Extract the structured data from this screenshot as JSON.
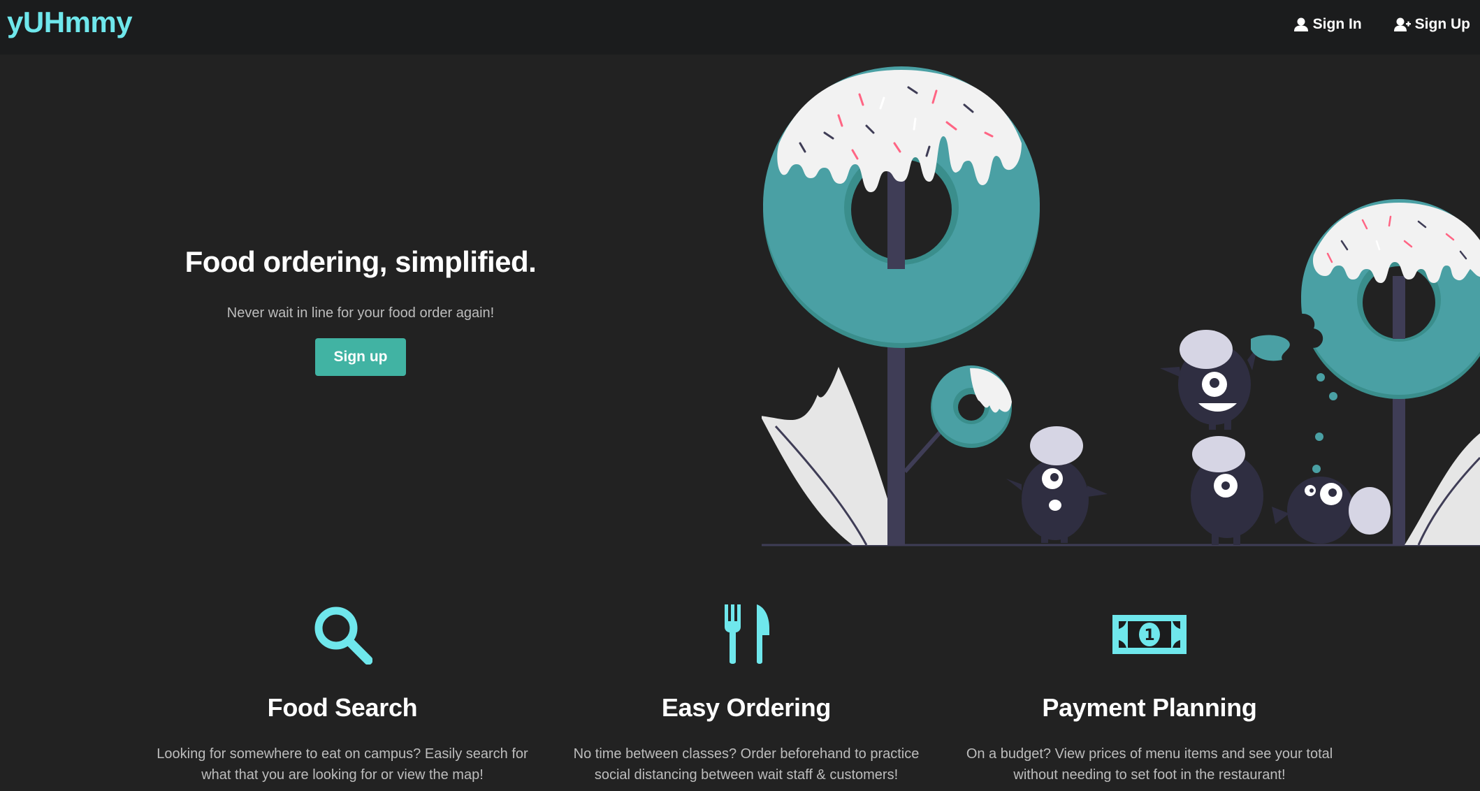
{
  "nav": {
    "brand": "yUHmmy",
    "sign_in": "Sign In",
    "sign_up": "Sign Up",
    "sign_in_icon": "user-icon",
    "sign_up_icon": "user-plus-icon"
  },
  "hero": {
    "title": "Food ordering, simplified.",
    "subtitle": "Never wait in line for your food order again!",
    "cta": "Sign up"
  },
  "features": [
    {
      "icon": "search-icon",
      "title": "Food Search",
      "description": "Looking for somewhere to eat on campus? Easily search for what that you are looking for or view the map!"
    },
    {
      "icon": "utensils-icon",
      "title": "Easy Ordering",
      "description": "No time between classes? Order beforehand to practice social distancing between wait staff & customers!"
    },
    {
      "icon": "money-bill-icon",
      "title": "Payment Planning",
      "description": "On a budget? View prices of menu items and see your total without needing to set foot in the restaurant!"
    }
  ],
  "colors": {
    "background": "#222222",
    "navbar": "#1b1c1d",
    "brand": "#6fe7ec",
    "accent": "#41b3a3",
    "icon": "#6fe7ec"
  }
}
